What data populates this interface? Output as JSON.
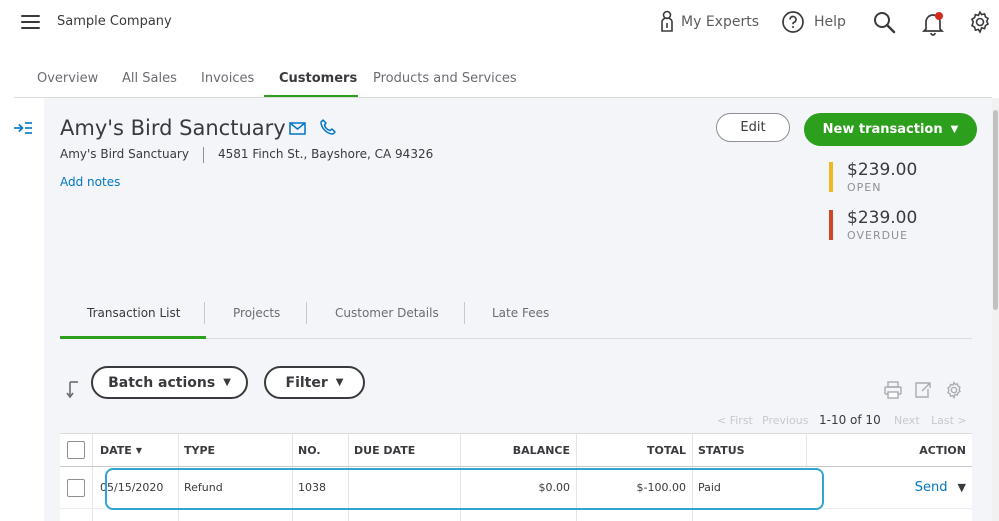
{
  "header": {
    "company": "Sample Company",
    "my_experts": "My Experts",
    "help": "Help"
  },
  "nav": {
    "tabs": [
      "Overview",
      "All Sales",
      "Invoices",
      "Customers",
      "Products and Services"
    ],
    "active": "Customers"
  },
  "customer": {
    "name": "Amy's Bird Sanctuary",
    "company": "Amy's Bird Sanctuary",
    "address": "4581 Finch St., Bayshore, CA 94326",
    "add_notes": "Add notes"
  },
  "actions": {
    "edit": "Edit",
    "new_transaction": "New transaction"
  },
  "balances": {
    "open_amount": "$239.00",
    "open_label": "OPEN",
    "overdue_amount": "$239.00",
    "overdue_label": "OVERDUE"
  },
  "subtabs": [
    "Transaction List",
    "Projects",
    "Customer Details",
    "Late Fees"
  ],
  "toolbar": {
    "batch_actions": "Batch actions",
    "filter": "Filter"
  },
  "pager": {
    "first": "< First",
    "previous": "Previous",
    "count": "1-10 of 10",
    "next": "Next",
    "last": "Last >"
  },
  "table": {
    "columns": [
      "DATE",
      "TYPE",
      "NO.",
      "DUE DATE",
      "BALANCE",
      "TOTAL",
      "STATUS",
      "ACTION"
    ],
    "rows": [
      {
        "date": "05/15/2020",
        "type": "Refund",
        "no": "1038",
        "due_date": "",
        "balance": "$0.00",
        "total": "$-100.00",
        "status": "Paid",
        "action": "Send"
      }
    ]
  },
  "colors": {
    "accent_green": "#2ca01c",
    "link_blue": "#0077c5",
    "open_bar": "#f2b824",
    "overdue_bar": "#d04528",
    "highlight": "#31a5cf"
  }
}
